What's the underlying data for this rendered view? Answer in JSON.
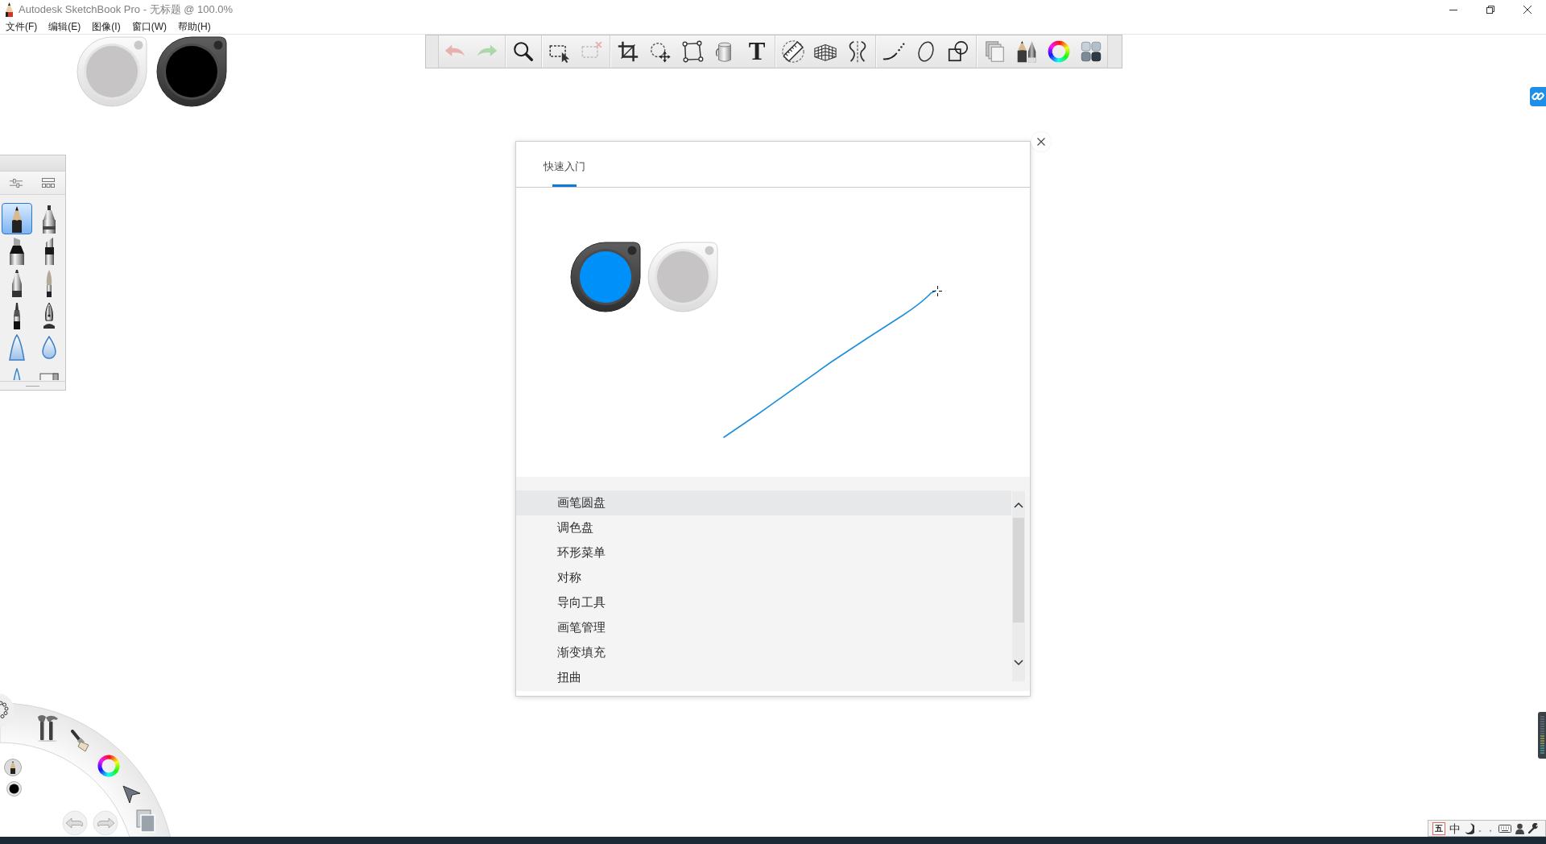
{
  "window": {
    "title": "Autodesk SketchBook Pro - 无标题 @ 100.0%"
  },
  "menu_bar": [
    "文件(F)",
    "编辑(E)",
    "图像(I)",
    "窗口(W)",
    "帮助(H)"
  ],
  "pucks": [
    {
      "kind": "brush"
    },
    {
      "kind": "color",
      "color": "#000000"
    }
  ],
  "toolbar": {
    "groups": [
      [
        {
          "disabled": true
        },
        {
          "disabled": true
        }
      ],
      [
        {
          "disabled": false
        }
      ],
      [
        {
          "disabled": false
        },
        {
          "disabled": true
        }
      ],
      [
        {
          "disabled": false
        },
        {
          "disabled": false
        },
        {
          "disabled": false
        },
        {
          "disabled": false
        },
        {
          "glyph": "T",
          "disabled": false
        }
      ],
      [
        {
          "disabled": false
        },
        {
          "disabled": false
        },
        {
          "disabled": false
        }
      ],
      [
        {
          "disabled": false
        },
        {
          "disabled": false
        },
        {
          "disabled": false
        }
      ],
      [
        {
          "disabled": false
        },
        {
          "disabled": false
        },
        {
          "disabled": false
        },
        {
          "disabled": false
        }
      ]
    ]
  },
  "brush_palette": {
    "brushes": [
      {
        "selected": true
      },
      {
        "selected": false
      },
      {
        "selected": false
      },
      {
        "selected": false
      },
      {
        "selected": false
      },
      {
        "selected": false
      },
      {
        "selected": false
      },
      {
        "selected": false
      },
      {
        "selected": false
      },
      {
        "selected": false
      },
      {
        "selected": false
      },
      {
        "selected": false
      }
    ]
  },
  "quick_start": {
    "tabs": [
      {
        "label": "快速入门",
        "selected": true
      }
    ],
    "demo_pucks": [
      {
        "kind": "color",
        "color": "#0090fa"
      },
      {
        "kind": "brush"
      }
    ],
    "topics": [
      {
        "label": "画笔圆盘",
        "selected": true
      },
      {
        "label": "调色盘",
        "selected": false
      },
      {
        "label": "环形菜单",
        "selected": false
      },
      {
        "label": "对称",
        "selected": false
      },
      {
        "label": "导向工具",
        "selected": false
      },
      {
        "label": "画笔管理",
        "selected": false
      },
      {
        "label": "渐变填充",
        "selected": false
      },
      {
        "label": "扭曲",
        "selected": false
      }
    ]
  },
  "ime_bar": {
    "logo": "五",
    "language": "中",
    "punctuation": "。，"
  }
}
